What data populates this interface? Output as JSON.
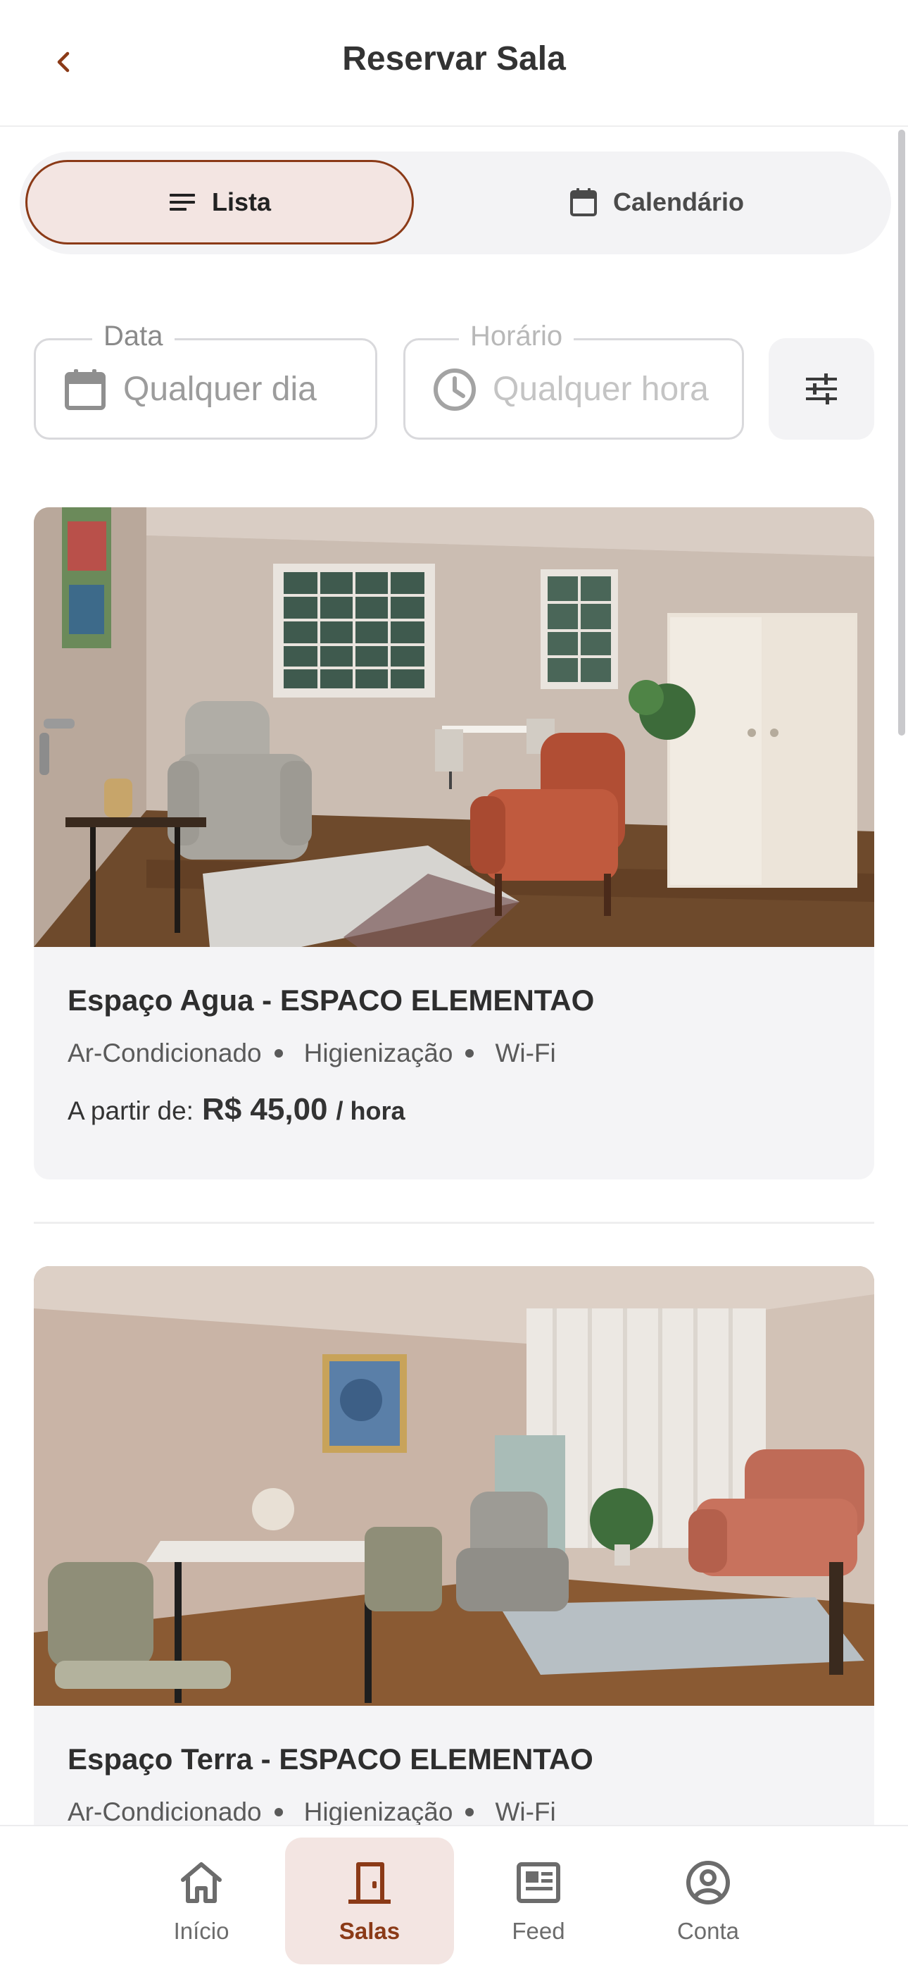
{
  "header": {
    "title": "Reservar Sala",
    "back_icon": "chevron-left-icon"
  },
  "view_toggle": {
    "list_label": "Lista",
    "calendar_label": "Calendário",
    "selected": "Lista"
  },
  "filters": {
    "date_label": "Data",
    "date_placeholder": "Qualquer dia",
    "time_label": "Horário",
    "time_placeholder": "Qualquer hora"
  },
  "rooms": [
    {
      "name": "Espaço Agua - ESPACO ELEMENTAO",
      "amenities": [
        "Ar-Condicionado",
        "Higienização",
        "Wi-Fi"
      ],
      "price_prefix": "A partir de:",
      "price": "R$ 45,00",
      "price_unit": "/ hora"
    },
    {
      "name": "Espaço Terra - ESPACO ELEMENTAO",
      "amenities": [
        "Ar-Condicionado",
        "Higienização",
        "Wi-Fi"
      ]
    }
  ],
  "bottom_nav": {
    "items": [
      {
        "label": "Início",
        "icon": "home-icon"
      },
      {
        "label": "Salas",
        "icon": "door-icon",
        "active": true
      },
      {
        "label": "Feed",
        "icon": "newspaper-icon"
      },
      {
        "label": "Conta",
        "icon": "user-circle-icon"
      }
    ]
  },
  "colors": {
    "accent": "#8b3a17",
    "accent_light": "#f3e5e2",
    "card_bg": "#f4f4f6"
  }
}
